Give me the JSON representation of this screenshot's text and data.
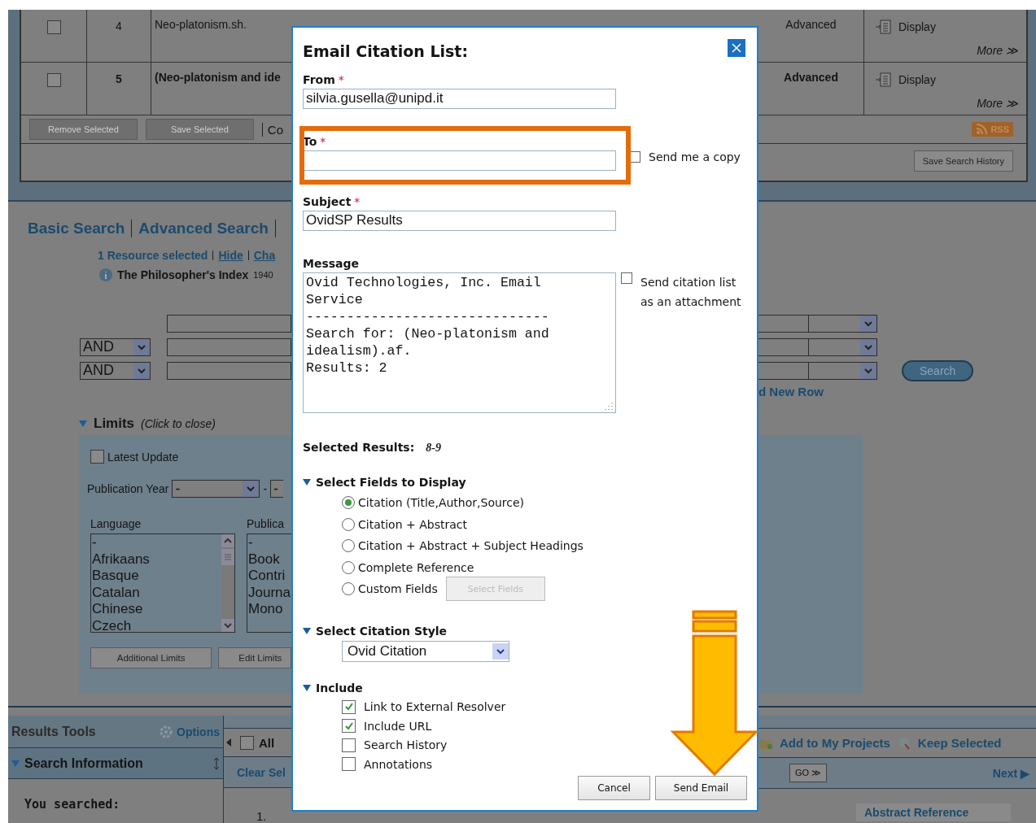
{
  "history": {
    "rows": [
      {
        "checked": false,
        "number": "4",
        "query": "Neo-platonism.sh.",
        "emphasized": false,
        "type": "Advanced",
        "display": "Display",
        "more": "More ≫"
      },
      {
        "checked": false,
        "number": "5",
        "query": "(Neo-platonism and ide",
        "emphasized": true,
        "type": "Advanced",
        "display": "Display",
        "more": "More ≫"
      }
    ],
    "buttons": [
      {
        "label": "Remove Selected",
        "disabled": true
      },
      {
        "label": "Save Selected",
        "disabled": true
      }
    ],
    "combine": "Co",
    "rss": "RSS",
    "save_history": "Save Search History"
  },
  "search": {
    "tabs": [
      "Basic Search",
      "Advanced Search"
    ],
    "resource_count": "1 Resource selected",
    "hide": "Hide",
    "change": "Cha",
    "database": "The Philosopher's Index",
    "years": "1940",
    "rows": [
      {
        "kind": "first"
      },
      {
        "kind": "combined",
        "operator": "AND"
      },
      {
        "kind": "combined",
        "operator": "AND"
      }
    ],
    "search_button": "Search",
    "add_row": "d New Row"
  },
  "limits": {
    "title": "Limits",
    "hint": "(Click to close)",
    "expanded": true,
    "latest_update": {
      "label": "Latest Update",
      "checked": false
    },
    "year_label": "Publication Year",
    "year_from": "-",
    "year_separator": "-",
    "year_to": "-",
    "language_label": "Language",
    "languages": [
      "-",
      "Afrikaans",
      "Basque",
      "Catalan",
      "Chinese",
      "Czech"
    ],
    "type_label": "Publica",
    "types": [
      "-",
      "Book",
      "Contri",
      "Journa",
      "Mono"
    ],
    "buttons": [
      "Additional Limits",
      "Edit Limits"
    ]
  },
  "results": {
    "tools_title": "Results Tools",
    "options": "Options",
    "info_title": "Search Information",
    "info_expanded": true,
    "you_searched": "You searched:",
    "all_label": "All",
    "all_checked": false,
    "clear": "Clear Sel",
    "first_number": "1.",
    "actions": [
      "Add to My Projects",
      "Keep Selected"
    ],
    "go": "GO ≫",
    "next": "Next ▶",
    "abstract": "Abstract Reference"
  },
  "dialog": {
    "title": "Email Citation List:",
    "from": {
      "label": "From",
      "mark": "*",
      "value": "silvia.gusella@unipd.it"
    },
    "to": {
      "label": "To",
      "mark": "*"
    },
    "send_copy": {
      "label": "Send me a copy",
      "checked": false
    },
    "subject": {
      "label": "Subject",
      "mark": "*",
      "value": "OvidSP Results"
    },
    "message": {
      "label": "Message",
      "value": "Ovid Technologies, Inc. Email Service\n------------------------------\nSearch for: (Neo-platonism and idealism).af.\nResults: 2"
    },
    "attachment": {
      "label": "Send citation list as an attachment",
      "checked": false
    },
    "selected_results": {
      "label": "Selected Results:",
      "value": "8-9"
    },
    "fields_section": {
      "title": "Select Fields to Display",
      "expanded": true,
      "options": [
        {
          "label": "Citation (Title,Author,Source)",
          "selected": true
        },
        {
          "label": "Citation + Abstract",
          "selected": false
        },
        {
          "label": "Citation + Abstract + Subject Headings",
          "selected": false
        },
        {
          "label": "Complete Reference",
          "selected": false
        },
        {
          "label": "Custom Fields",
          "selected": false
        }
      ],
      "select_fields": {
        "label": "Select Fields",
        "disabled": true
      }
    },
    "style_section": {
      "title": "Select Citation Style",
      "expanded": true,
      "value": "Ovid Citation"
    },
    "include_section": {
      "title": "Include",
      "expanded": true,
      "options": [
        {
          "label": "Link to External Resolver",
          "checked": true
        },
        {
          "label": "Include URL",
          "checked": true
        },
        {
          "label": "Search History",
          "checked": false
        },
        {
          "label": "Annotations",
          "checked": false
        }
      ]
    },
    "buttons": [
      "Cancel",
      "Send Email"
    ]
  }
}
